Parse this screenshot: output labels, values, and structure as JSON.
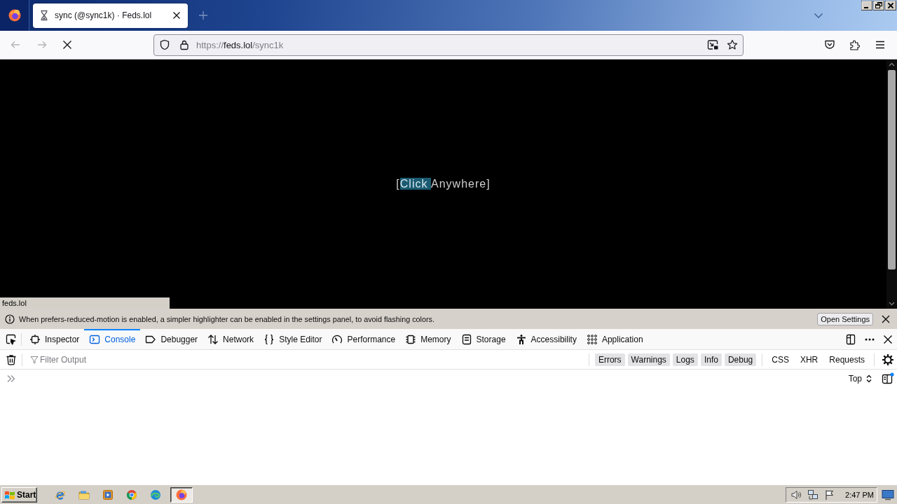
{
  "window": {
    "tab": {
      "title": "sync (@sync1k) · Feds.lol",
      "loading": true
    }
  },
  "toolbar": {
    "back": {
      "disabled": true
    },
    "forward": {
      "disabled": true
    },
    "address_bar": {
      "scheme": "https://",
      "host": "feds.lol",
      "path": "/sync1k"
    }
  },
  "page": {
    "prompt_parts": [
      {
        "text": "[",
        "highlighted": false
      },
      {
        "text": "Click ",
        "highlighted": true
      },
      {
        "text": "Anywhere]",
        "highlighted": false
      }
    ]
  },
  "status_text": "feds.lol",
  "devtools": {
    "notification": {
      "message": "When prefers-reduced-motion is enabled, a simpler highlighter can be enabled in the settings panel, to avoid flashing colors.",
      "button": "Open Settings"
    },
    "tabs": [
      {
        "kind": "inspector",
        "label": "Inspector",
        "selected": false
      },
      {
        "kind": "console",
        "label": "Console",
        "selected": true
      },
      {
        "kind": "debugger",
        "label": "Debugger",
        "selected": false
      },
      {
        "kind": "network",
        "label": "Network",
        "selected": false
      },
      {
        "kind": "style",
        "label": "Style Editor",
        "selected": false
      },
      {
        "kind": "performance",
        "label": "Performance",
        "selected": false
      },
      {
        "kind": "memory",
        "label": "Memory",
        "selected": false
      },
      {
        "kind": "storage",
        "label": "Storage",
        "selected": false
      },
      {
        "kind": "accessibility",
        "label": "Accessibility",
        "selected": false
      },
      {
        "kind": "application",
        "label": "Application",
        "selected": false
      }
    ],
    "filter": {
      "placeholder": "Filter Output"
    },
    "level_filters": [
      {
        "label": "Errors",
        "checked": true
      },
      {
        "label": "Warnings",
        "checked": true
      },
      {
        "label": "Logs",
        "checked": true
      },
      {
        "label": "Info",
        "checked": true
      },
      {
        "label": "Debug",
        "checked": true
      }
    ],
    "type_filters": [
      {
        "label": "CSS",
        "checked": false
      },
      {
        "label": "XHR",
        "checked": false
      },
      {
        "label": "Requests",
        "checked": false
      }
    ],
    "context": "Top"
  },
  "taskbar": {
    "start": "Start",
    "apps": [
      {
        "kind": "globe",
        "selected": false
      },
      {
        "kind": "folder",
        "selected": false
      },
      {
        "kind": "player",
        "selected": false
      },
      {
        "kind": "rings",
        "selected": false
      },
      {
        "kind": "wave",
        "selected": false
      },
      {
        "kind": "flame",
        "selected": true
      }
    ],
    "clock": "2:47 PM"
  }
}
